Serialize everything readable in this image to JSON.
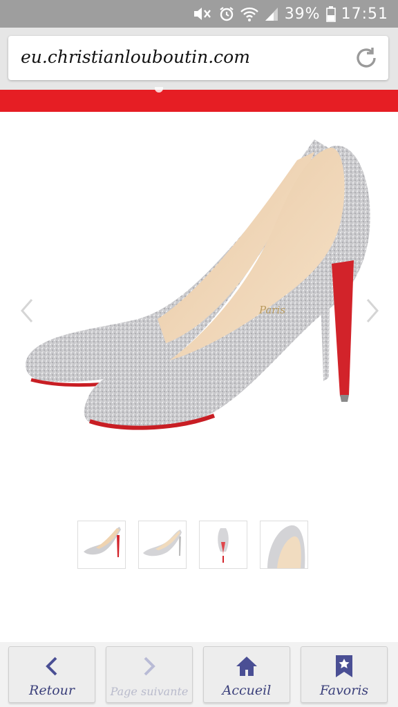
{
  "status_bar": {
    "battery": "39%",
    "time": "17:51"
  },
  "browser": {
    "url": "eu.christianlouboutin.com"
  },
  "product": {
    "brand_mark": "Paris",
    "thumbnails": [
      "thumbnail-side-pair",
      "thumbnail-side-single",
      "thumbnail-back",
      "thumbnail-top"
    ]
  },
  "bottom_nav": {
    "back_label": "Retour",
    "next_label": "Page suivante",
    "home_label": "Accueil",
    "favorites_label": "Favoris"
  },
  "colors": {
    "accent_red": "#e61e24",
    "nav_icon": "#4a4f94",
    "nav_icon_disabled": "#b9bbd6"
  }
}
